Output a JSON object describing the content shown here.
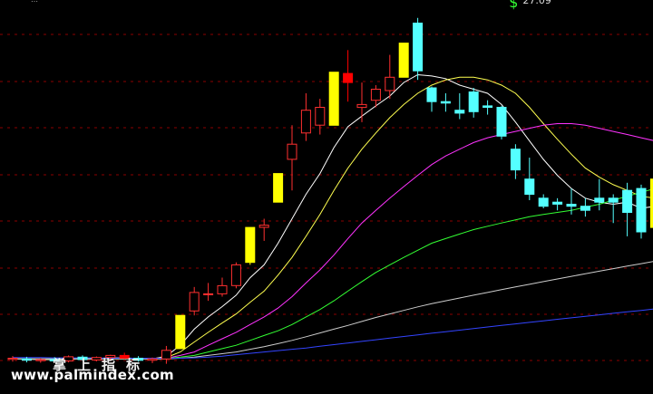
{
  "chart_data": {
    "type": "candlestick",
    "y_scale": "log",
    "ylim": [
      8.0,
      28.3
    ],
    "grid": true,
    "annotations": {
      "high_marker": {
        "symbol": "$",
        "value_label": "27.09",
        "bar": 36,
        "value": 27.09
      },
      "buy_marker": {
        "symbol": "B",
        "bar": 48
      }
    },
    "candles": [
      {
        "o": 8.19,
        "h": 8.28,
        "l": 8.12,
        "c": 8.22,
        "col": "red"
      },
      {
        "o": 8.2,
        "h": 8.26,
        "l": 8.1,
        "c": 8.16,
        "col": "cyan"
      },
      {
        "o": 8.15,
        "h": 8.22,
        "l": 8.09,
        "c": 8.18,
        "col": "red"
      },
      {
        "o": 8.18,
        "h": 8.25,
        "l": 8.12,
        "c": 8.14,
        "col": "cyan"
      },
      {
        "o": 8.14,
        "h": 8.3,
        "l": 8.1,
        "c": 8.26,
        "col": "red"
      },
      {
        "o": 8.25,
        "h": 8.3,
        "l": 8.15,
        "c": 8.18,
        "col": "cyan"
      },
      {
        "o": 8.17,
        "h": 8.27,
        "l": 8.13,
        "c": 8.24,
        "col": "red"
      },
      {
        "o": 8.24,
        "h": 8.32,
        "l": 8.18,
        "c": 8.3,
        "col": "red"
      },
      {
        "o": 8.3,
        "h": 8.38,
        "l": 8.2,
        "c": 8.22,
        "col": "fill_red"
      },
      {
        "o": 8.22,
        "h": 8.28,
        "l": 8.12,
        "c": 8.16,
        "col": "cyan"
      },
      {
        "o": 8.16,
        "h": 8.24,
        "l": 8.08,
        "c": 8.2,
        "col": "red"
      },
      {
        "o": 8.2,
        "h": 8.58,
        "l": 8.06,
        "c": 8.45,
        "col": "red"
      },
      {
        "o": 8.5,
        "h": 9.55,
        "l": 8.5,
        "c": 9.55,
        "col": "yellow"
      },
      {
        "o": 9.7,
        "h": 10.55,
        "l": 9.55,
        "c": 10.35,
        "col": "red"
      },
      {
        "o": 10.3,
        "h": 10.7,
        "l": 10.05,
        "c": 10.3,
        "col": "red"
      },
      {
        "o": 10.3,
        "h": 10.9,
        "l": 10.2,
        "c": 10.6,
        "col": "red"
      },
      {
        "o": 10.6,
        "h": 11.5,
        "l": 10.5,
        "c": 11.4,
        "col": "red"
      },
      {
        "o": 11.5,
        "h": 13.0,
        "l": 11.4,
        "c": 13.0,
        "col": "yellow"
      },
      {
        "o": 13.1,
        "h": 13.4,
        "l": 12.4,
        "c": 13.0,
        "col": "red"
      },
      {
        "o": 14.2,
        "h": 15.7,
        "l": 14.2,
        "c": 15.7,
        "col": "yellow"
      },
      {
        "o": 16.5,
        "h": 18.6,
        "l": 14.8,
        "c": 17.4,
        "col": "red"
      },
      {
        "o": 18.1,
        "h": 20.8,
        "l": 17.6,
        "c": 19.6,
        "col": "red"
      },
      {
        "o": 18.6,
        "h": 20.4,
        "l": 18.0,
        "c": 19.8,
        "col": "red"
      },
      {
        "o": 18.6,
        "h": 22.4,
        "l": 18.6,
        "c": 22.4,
        "col": "yellow"
      },
      {
        "o": 21.6,
        "h": 24.2,
        "l": 20.2,
        "c": 22.3,
        "col": "fill_red"
      },
      {
        "o": 19.8,
        "h": 21.6,
        "l": 18.8,
        "c": 20.0,
        "col": "red"
      },
      {
        "o": 20.3,
        "h": 21.4,
        "l": 19.8,
        "c": 21.1,
        "col": "red"
      },
      {
        "o": 21.0,
        "h": 23.8,
        "l": 20.4,
        "c": 22.0,
        "col": "red"
      },
      {
        "o": 22.0,
        "h": 24.8,
        "l": 22.0,
        "c": 24.8,
        "col": "yellow"
      },
      {
        "o": 26.6,
        "h": 27.09,
        "l": 21.8,
        "c": 22.5,
        "col": "cyan"
      },
      {
        "o": 21.2,
        "h": 21.3,
        "l": 19.5,
        "c": 20.2,
        "col": "cyan"
      },
      {
        "o": 20.2,
        "h": 20.8,
        "l": 19.5,
        "c": 20.1,
        "col": "cyan"
      },
      {
        "o": 19.4,
        "h": 20.8,
        "l": 19.0,
        "c": 19.6,
        "col": "cyan"
      },
      {
        "o": 20.9,
        "h": 21.2,
        "l": 19.1,
        "c": 19.5,
        "col": "cyan"
      },
      {
        "o": 19.9,
        "h": 20.3,
        "l": 19.3,
        "c": 19.8,
        "col": "cyan"
      },
      {
        "o": 19.8,
        "h": 19.9,
        "l": 17.7,
        "c": 17.9,
        "col": "cyan"
      },
      {
        "o": 17.1,
        "h": 17.4,
        "l": 15.4,
        "c": 15.9,
        "col": "cyan"
      },
      {
        "o": 15.4,
        "h": 16.6,
        "l": 14.3,
        "c": 14.6,
        "col": "cyan"
      },
      {
        "o": 14.4,
        "h": 14.6,
        "l": 13.9,
        "c": 14.0,
        "col": "cyan"
      },
      {
        "o": 14.2,
        "h": 14.4,
        "l": 13.8,
        "c": 14.1,
        "col": "cyan"
      },
      {
        "o": 14.1,
        "h": 14.9,
        "l": 13.6,
        "c": 14.0,
        "col": "cyan"
      },
      {
        "o": 14.0,
        "h": 14.4,
        "l": 13.5,
        "c": 13.8,
        "col": "cyan"
      },
      {
        "o": 14.2,
        "h": 15.4,
        "l": 13.8,
        "c": 14.4,
        "col": "cyan"
      },
      {
        "o": 14.4,
        "h": 14.6,
        "l": 13.2,
        "c": 14.2,
        "col": "cyan"
      },
      {
        "o": 13.7,
        "h": 15.2,
        "l": 12.6,
        "c": 14.8,
        "col": "cyan"
      },
      {
        "o": 14.9,
        "h": 15.1,
        "l": 12.5,
        "c": 12.8,
        "col": "cyan"
      },
      {
        "o": 13.0,
        "h": 15.4,
        "l": 12.9,
        "c": 15.4,
        "col": "yellow"
      }
    ],
    "series": [
      {
        "color": "#ffffff",
        "values": [
          8.2,
          8.19,
          8.18,
          8.18,
          8.2,
          8.2,
          8.21,
          8.23,
          8.23,
          8.21,
          8.2,
          8.28,
          8.6,
          9.1,
          9.5,
          9.85,
          10.25,
          10.9,
          11.4,
          12.3,
          13.4,
          14.6,
          15.7,
          17.2,
          18.5,
          19.2,
          19.9,
          20.6,
          21.6,
          22.2,
          22.1,
          21.9,
          21.4,
          21.1,
          20.8,
          20.0,
          18.8,
          17.6,
          16.5,
          15.6,
          14.9,
          14.4,
          14.2,
          14.1,
          14.2,
          13.9,
          14.0
        ]
      },
      {
        "color": "#ffff50",
        "values": [
          8.2,
          8.2,
          8.19,
          8.19,
          8.19,
          8.2,
          8.2,
          8.21,
          8.22,
          8.21,
          8.21,
          8.24,
          8.4,
          8.7,
          9.0,
          9.3,
          9.6,
          10.0,
          10.4,
          11.0,
          11.7,
          12.6,
          13.6,
          14.8,
          16.0,
          17.1,
          18.1,
          19.1,
          20.0,
          20.8,
          21.4,
          21.8,
          22.0,
          22.0,
          21.8,
          21.4,
          20.8,
          19.8,
          18.7,
          17.7,
          16.8,
          16.0,
          15.5,
          15.1,
          14.8,
          14.5,
          14.4
        ]
      },
      {
        "color": "#ff33ff",
        "values": [
          8.2,
          8.2,
          8.2,
          8.2,
          8.2,
          8.2,
          8.2,
          8.21,
          8.21,
          8.21,
          8.21,
          8.22,
          8.3,
          8.4,
          8.6,
          8.8,
          9.0,
          9.25,
          9.5,
          9.8,
          10.2,
          10.7,
          11.2,
          11.8,
          12.5,
          13.2,
          13.8,
          14.4,
          15.0,
          15.6,
          16.2,
          16.7,
          17.1,
          17.5,
          17.8,
          18.0,
          18.2,
          18.4,
          18.6,
          18.7,
          18.7,
          18.6,
          18.4,
          18.2,
          18.0,
          17.8,
          17.6
        ]
      },
      {
        "color": "#33ff33",
        "values": [
          8.2,
          8.2,
          8.2,
          8.2,
          8.2,
          8.2,
          8.2,
          8.2,
          8.2,
          8.2,
          8.2,
          8.21,
          8.25,
          8.3,
          8.4,
          8.5,
          8.6,
          8.75,
          8.9,
          9.05,
          9.25,
          9.5,
          9.75,
          10.05,
          10.4,
          10.75,
          11.1,
          11.4,
          11.7,
          12.0,
          12.3,
          12.5,
          12.7,
          12.9,
          13.05,
          13.2,
          13.35,
          13.5,
          13.6,
          13.7,
          13.8,
          13.95,
          14.1,
          14.3,
          14.5,
          14.7,
          14.9
        ]
      },
      {
        "color": "#cccccc",
        "values": [
          8.2,
          8.2,
          8.2,
          8.2,
          8.2,
          8.2,
          8.2,
          8.2,
          8.2,
          8.2,
          8.2,
          8.2,
          8.22,
          8.25,
          8.3,
          8.35,
          8.4,
          8.48,
          8.56,
          8.65,
          8.75,
          8.86,
          8.98,
          9.1,
          9.22,
          9.35,
          9.48,
          9.6,
          9.72,
          9.84,
          9.95,
          10.05,
          10.15,
          10.25,
          10.35,
          10.45,
          10.55,
          10.65,
          10.75,
          10.85,
          10.95,
          11.05,
          11.15,
          11.25,
          11.35,
          11.45,
          11.55
        ]
      },
      {
        "color": "#3344ff",
        "values": [
          8.24,
          8.24,
          8.24,
          8.23,
          8.23,
          8.23,
          8.23,
          8.22,
          8.22,
          8.22,
          8.22,
          8.22,
          8.22,
          8.23,
          8.25,
          8.28,
          8.32,
          8.36,
          8.4,
          8.44,
          8.48,
          8.52,
          8.57,
          8.62,
          8.67,
          8.72,
          8.77,
          8.82,
          8.87,
          8.92,
          8.97,
          9.02,
          9.07,
          9.12,
          9.17,
          9.22,
          9.27,
          9.32,
          9.37,
          9.42,
          9.47,
          9.52,
          9.57,
          9.62,
          9.67,
          9.72,
          9.77
        ]
      }
    ],
    "top_partial_label": "…"
  },
  "watermark": {
    "cn": "掌上指标",
    "url": "www.palmindex.com"
  }
}
